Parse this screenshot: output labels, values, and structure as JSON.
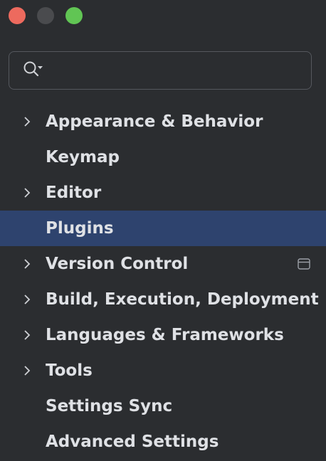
{
  "window": {
    "controls": [
      "close",
      "minimize",
      "maximize"
    ]
  },
  "search": {
    "placeholder": "",
    "value": "",
    "icon": "search-with-options-icon"
  },
  "tree": {
    "items": [
      {
        "label": "Appearance & Behavior",
        "expandable": true
      },
      {
        "label": "Keymap",
        "expandable": false
      },
      {
        "label": "Editor",
        "expandable": true
      },
      {
        "label": "Plugins",
        "expandable": false,
        "selected": true
      },
      {
        "label": "Version Control",
        "expandable": true,
        "badge_icon": "project-level-icon"
      },
      {
        "label": "Build, Execution, Deployment",
        "expandable": true
      },
      {
        "label": "Languages & Frameworks",
        "expandable": true
      },
      {
        "label": "Tools",
        "expandable": true
      },
      {
        "label": "Settings Sync",
        "expandable": false
      },
      {
        "label": "Advanced Settings",
        "expandable": false
      }
    ]
  },
  "colors": {
    "background": "#2b2d30",
    "selection": "#2e436e",
    "text": "#dfe1e5",
    "close": "#ed6a5e",
    "minimize": "#4a4b4e",
    "maximize": "#61c554"
  }
}
